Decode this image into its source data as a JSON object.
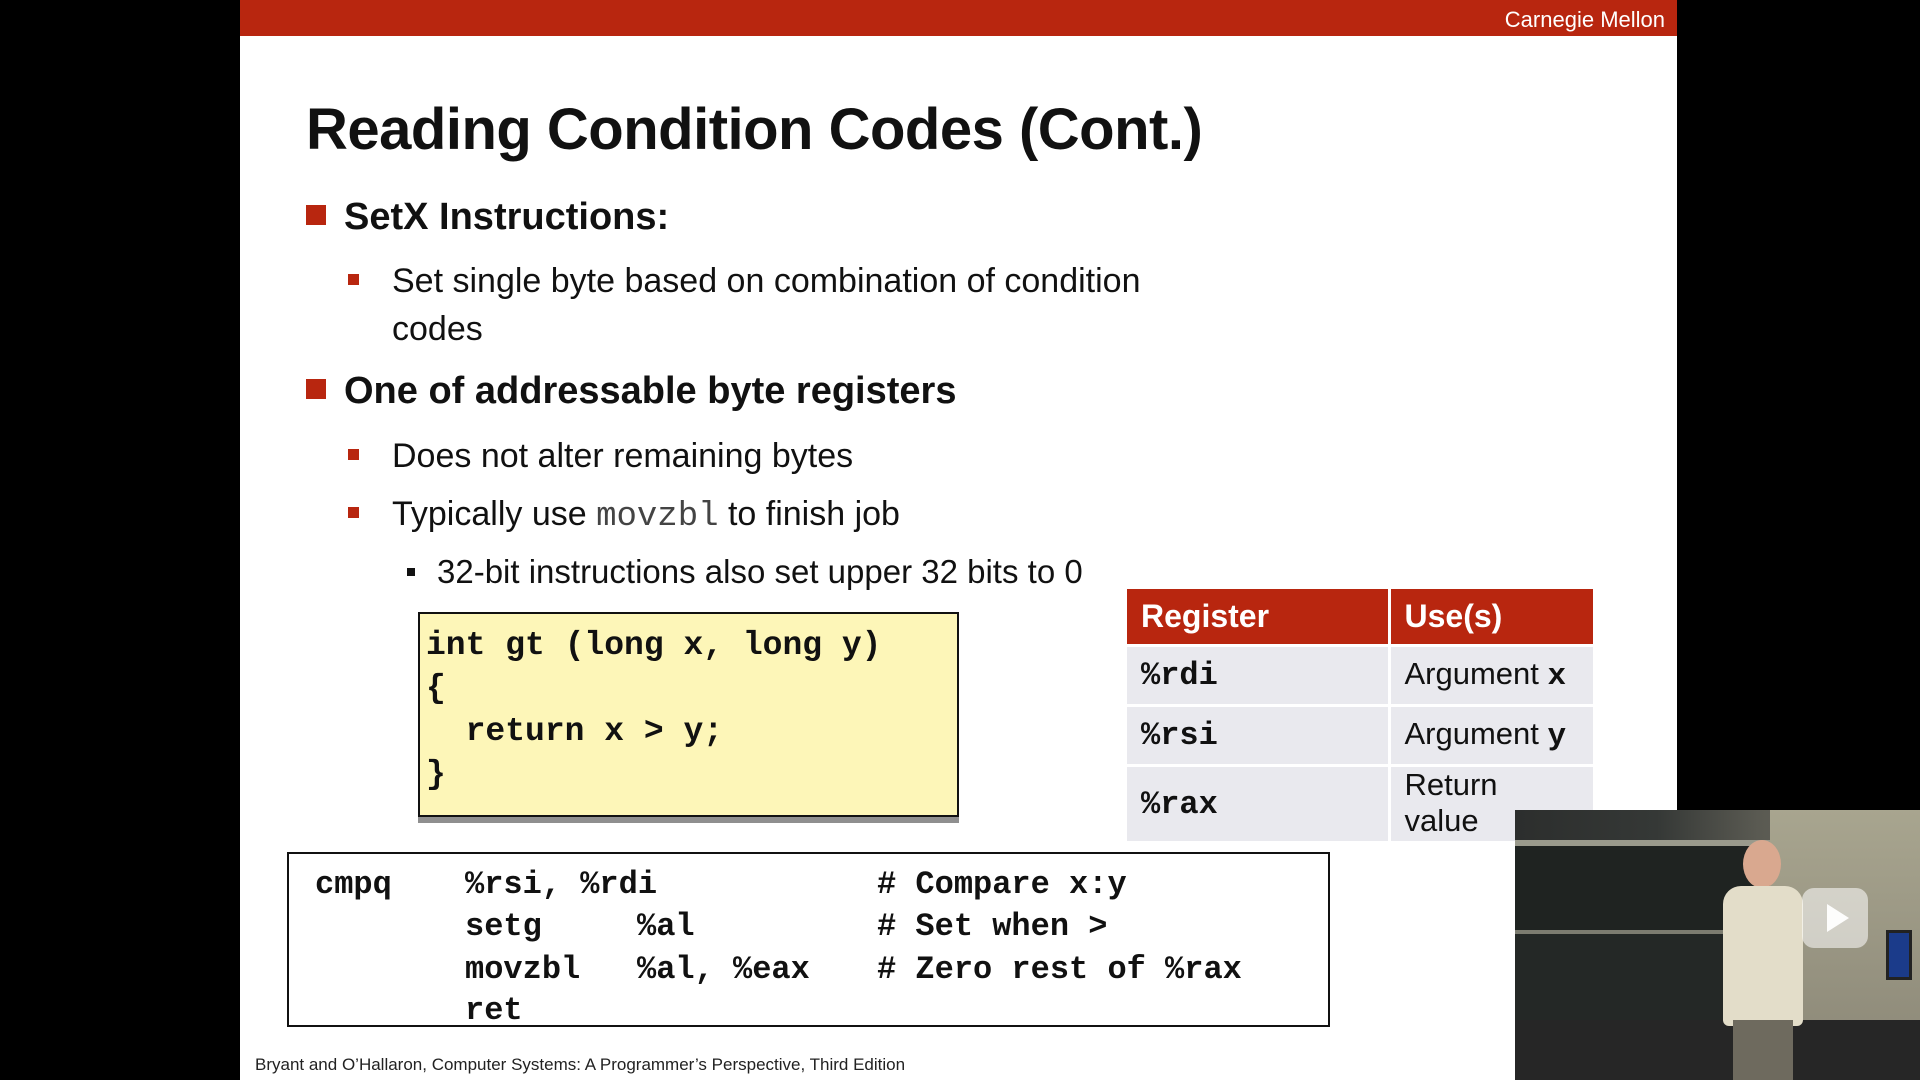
{
  "header": {
    "brand": "Carnegie Mellon"
  },
  "slide": {
    "title": "Reading Condition Codes (Cont.)",
    "bullets": {
      "setx_heading": "SetX Instructions:",
      "setx_line1": "Set single byte based on combination of condition",
      "setx_line2": "codes",
      "byte_heading": "One of addressable byte registers",
      "byte_sub1": "Does not alter remaining bytes",
      "byte_sub2_before": "Typically use ",
      "byte_sub2_code": "movzbl",
      "byte_sub2_after": " to finish job",
      "byte_sub3": "32-bit instructions also set upper 32 bits to 0"
    },
    "c_code": [
      "int gt (long x, long y)",
      "{",
      "  return x > y;",
      "}"
    ],
    "register_table": {
      "headers": [
        "Register",
        "Use(s)"
      ],
      "rows": [
        {
          "register": "%rdi",
          "use_text": "Argument ",
          "use_code": "x"
        },
        {
          "register": "%rsi",
          "use_text": "Argument ",
          "use_code": "y"
        },
        {
          "register": "%rax",
          "use_text": "Return value",
          "use_code": ""
        }
      ]
    },
    "asm": [
      {
        "op": "cmpq",
        "instr": "",
        "args": "%rsi, %rdi",
        "comment": "# Compare x:y"
      },
      {
        "op": "",
        "instr": "setg",
        "args": "%al",
        "comment": "# Set when >"
      },
      {
        "op": "",
        "instr": "movzbl",
        "args": "%al, %eax",
        "comment": "# Zero rest of %rax"
      },
      {
        "op": "",
        "instr": "ret",
        "args": "",
        "comment": ""
      }
    ],
    "footer": "Bryant and O’Hallaron, Computer Systems: A Programmer’s Perspective, Third Edition"
  },
  "colors": {
    "accent_red": "#b8260f",
    "code_box_bg": "#fdf6b8",
    "table_row_bg": "#e9e9ee"
  },
  "webcam": {
    "overlay_icon": "play-icon"
  }
}
